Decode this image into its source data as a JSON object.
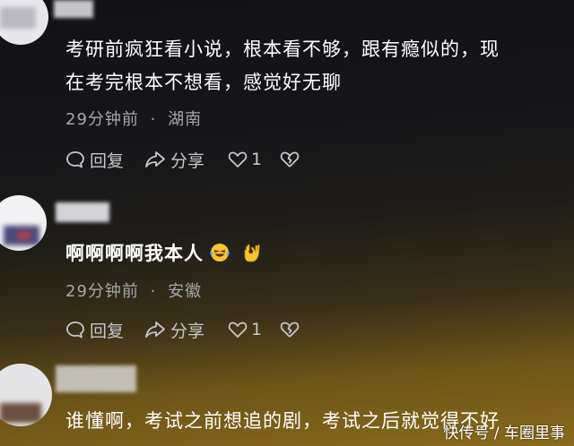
{
  "comments": [
    {
      "text_line1": "考研前疯狂看小说，根本看不够，跟有瘾似的，现",
      "text_line2": "在考完根本不想看，感觉好无聊",
      "time": "29分钟前",
      "location": "湖南",
      "like_count": "1"
    },
    {
      "text": "啊啊啊啊我本人",
      "time": "29分钟前",
      "location": "安徽",
      "like_count": "1"
    },
    {
      "text": "谁懂啊，考试之前想追的剧，考试之后就觉得不好"
    }
  ],
  "actions": {
    "reply_label": "回复",
    "share_label": "分享"
  },
  "meta_separator": "·",
  "watermark": "快传号 / 车圈里事",
  "colors": {
    "text": "#ffffff",
    "meta": "#a6a6ac",
    "action": "#c6c6cc",
    "background_top": "#121216",
    "background_bottom": "#8a6a1c"
  }
}
